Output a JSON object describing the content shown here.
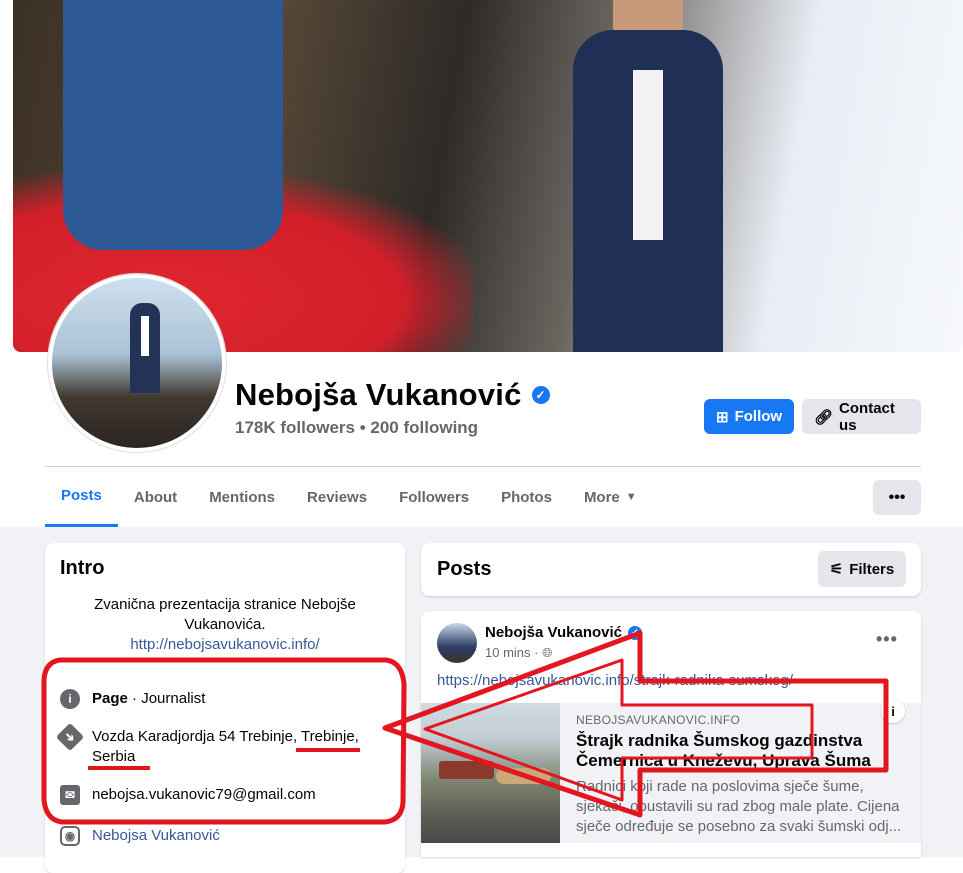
{
  "profile": {
    "name": "Nebojša Vukanović",
    "stats": "178K followers • 200 following",
    "follow_label": "Follow",
    "contact_label": "Contact us",
    "verified_icon": "verified-badge-icon"
  },
  "tabs": [
    {
      "label": "Posts",
      "active": true
    },
    {
      "label": "About"
    },
    {
      "label": "Mentions"
    },
    {
      "label": "Reviews"
    },
    {
      "label": "Followers"
    },
    {
      "label": "Photos"
    },
    {
      "label": "More"
    }
  ],
  "intro": {
    "title": "Intro",
    "bio": "Zvanična prezentacija stranice Nebojše Vukanovića.",
    "bio_link": "http://nebojsavukanovic.info/",
    "page_type": "Page",
    "page_category": "Journalist",
    "address": "Vozda Karadjordja 54 Trebinje, Trebinje, Serbia",
    "email": "nebojsa.vukanovic79@gmail.com",
    "instagram": "Nebojsa Vukanović"
  },
  "posts": {
    "title": "Posts",
    "filters_label": "Filters",
    "post": {
      "author": "Nebojša Vukanović",
      "time": "10 mins ·",
      "url": "https://nebojsavukanovic.info/strajk-radnika-sumskog/",
      "preview": {
        "domain": "NEBOJSAVUKANOVIC.INFO",
        "title": "Štrajk radnika Šumskog gazdinstva Čemernica u Kneževu, Uprava Šuma",
        "description": "Radnici koji rade na poslovima sječe šume, sjekači, obustavili su rad zbog male plate. Cijena sječe određuje se posebno za svaki šumski odj..."
      }
    }
  },
  "colors": {
    "accent": "#1877f2",
    "annotation": "#e3161f",
    "background": "#f0f2f5"
  }
}
